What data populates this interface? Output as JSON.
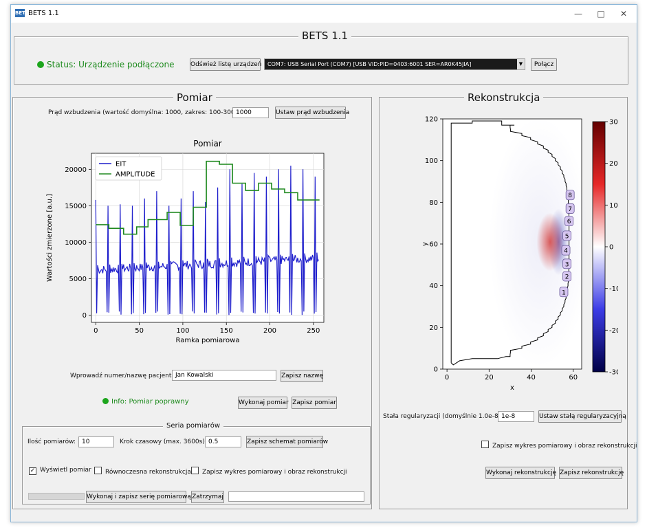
{
  "window": {
    "title": "BETS 1.1",
    "app_icon": "BETS",
    "min": "—",
    "max": "□",
    "close": "✕"
  },
  "header": {
    "title": "BETS 1.1",
    "status": "Status: Urządzenie podłączone",
    "refresh_label": "Odśwież listę urządzeń",
    "port_value": "COM7: USB Serial Port (COM7) [USB VID:PID=0403:6001 SER=AR0K45JIA]",
    "connect_label": "Połącz"
  },
  "measurement": {
    "title": "Pomiar",
    "current_label": "Prąd wzbudzenia (wartość domyślna: 1000, zakres: 100-3000):",
    "current_value": "1000",
    "set_current_label": "Ustaw prąd wzbudzenia",
    "patient_label": "Wprowadź numer/nazwę pacjenta:",
    "patient_value": "Jan Kowalski",
    "save_name_label": "Zapisz nazwę",
    "info": "Info: Pomiar poprawny",
    "run_label": "Wykonaj pomiar",
    "save_label": "Zapisz pomiar"
  },
  "series": {
    "title": "Seria pomiarów",
    "count_label": "Ilość pomiarów:",
    "count_value": "10",
    "step_label": "Krok czasowy (max. 3600s):",
    "step_value": "0.5",
    "save_scheme_label": "Zapisz schemat pomiarów",
    "show_label": "Wyświetl pomiar",
    "show_checked": true,
    "simul_label": "Równoczesna rekonstrukcja",
    "simul_checked": false,
    "save_plot_label": "Zapisz wykres pomiarowy i obraz rekonstrukcji",
    "save_plot_checked": false,
    "progress": 0,
    "run_series_label": "Wykonaj i zapisz serię pomiarową",
    "stop_label": "Zatrzymaj"
  },
  "reconstruction": {
    "title": "Rekonstrukcja",
    "reg_label": "Stała regularyzacji (domyślnie 1.0e-8):",
    "reg_value": "1e-8",
    "set_reg_label": "Ustaw stałą regularyzacyjną",
    "save_plot_label": "Zapisz wykres pomiarowy i obraz rekonstrukcji",
    "save_plot_checked": false,
    "run_label": "Wykonaj rekonstrukcję",
    "save_label": "Zapisz rekonstrukcję"
  },
  "chart_data": [
    {
      "type": "line",
      "title": "Pomiar",
      "xlabel": "Ramka pomiarowa",
      "ylabel": "Wartości zmierzone [a.u.]",
      "xlim": [
        -5,
        262
      ],
      "ylim": [
        -1000,
        22200
      ],
      "xticks": [
        0,
        50,
        100,
        150,
        200,
        250
      ],
      "yticks": [
        0,
        5000,
        10000,
        15000,
        20000
      ],
      "grid": true,
      "legend": "top-left",
      "series": [
        {
          "name": "EIT",
          "color": "#1f1fcc",
          "kind": "signal",
          "peaks": [
            15800,
            15000,
            15200,
            15000,
            16000,
            17000,
            15000,
            16000,
            17000,
            15500,
            17500,
            20000,
            18000,
            19500,
            19000,
            20000,
            20500,
            20000,
            19000
          ],
          "period": 14,
          "baseline": [
            6200,
            7800
          ],
          "drops": [
            0,
            500
          ]
        },
        {
          "name": "AMPLITUDE",
          "color": "#208a20",
          "kind": "step",
          "x": [
            0,
            15,
            32,
            47,
            60,
            82,
            97,
            112,
            127,
            142,
            157,
            172,
            187,
            202,
            217,
            232,
            257
          ],
          "values": [
            12400,
            11900,
            11100,
            12100,
            13100,
            14100,
            12300,
            14800,
            21100,
            20700,
            18100,
            17100,
            18100,
            17300,
            16800,
            15800,
            15800
          ]
        }
      ]
    },
    {
      "type": "heatmap",
      "xlabel": "x",
      "ylabel": "y",
      "xlim": [
        -2,
        64
      ],
      "ylim": [
        0,
        120
      ],
      "xticks": [
        0,
        20,
        40,
        60
      ],
      "yticks": [
        0,
        20,
        40,
        60,
        80,
        100,
        120
      ],
      "colorbar": {
        "min": -30,
        "max": 30,
        "ticks": [
          30,
          20,
          10,
          0,
          -10,
          -20,
          -30
        ],
        "colormap": "seismic"
      },
      "blobs": [
        {
          "x": 49,
          "y": 61,
          "value": 22,
          "rx": 3.2,
          "ry": 7
        },
        {
          "x": 53,
          "y": 61,
          "value": -18,
          "rx": 2.4,
          "ry": 8
        },
        {
          "x": 44,
          "y": 61,
          "value": -6,
          "rx": 12,
          "ry": 30
        }
      ],
      "electrodes": [
        {
          "label": "1",
          "x": 55.5,
          "y": 37
        },
        {
          "label": "2",
          "x": 57,
          "y": 44.5
        },
        {
          "label": "3",
          "x": 57,
          "y": 50.5
        },
        {
          "label": "4",
          "x": 56.5,
          "y": 57
        },
        {
          "label": "5",
          "x": 57,
          "y": 64
        },
        {
          "label": "6",
          "x": 58,
          "y": 71
        },
        {
          "label": "7",
          "x": 58.5,
          "y": 77
        },
        {
          "label": "8",
          "x": 58.5,
          "y": 83.5
        }
      ]
    }
  ]
}
